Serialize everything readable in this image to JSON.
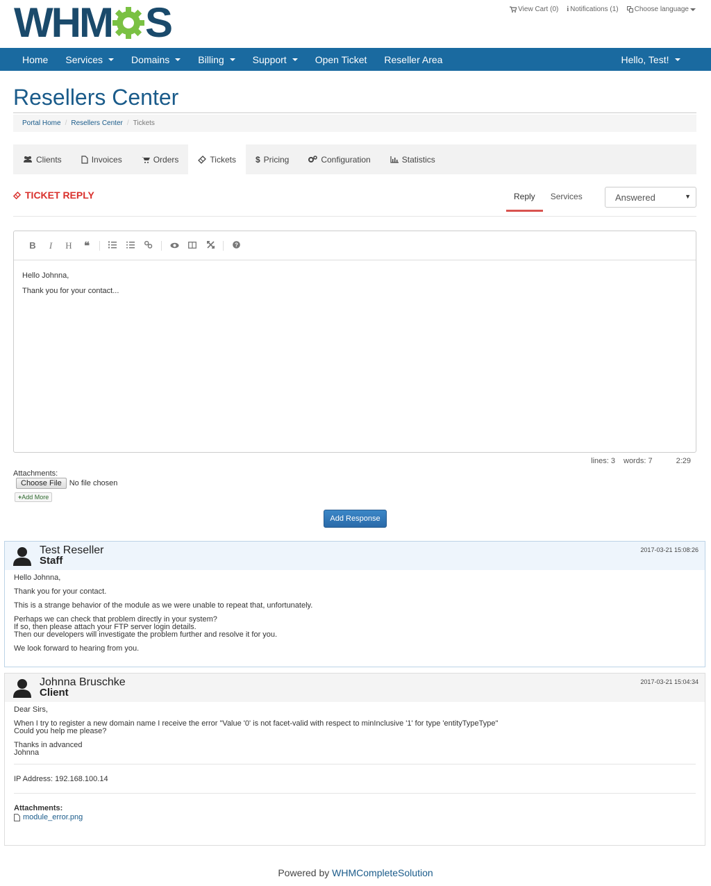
{
  "brand": {
    "logo_left": "WHM",
    "logo_right": "S",
    "logo_alt": "WHMCS"
  },
  "toplinks": {
    "cart": "View Cart (0)",
    "notifications": "Notifications (1)",
    "language": "Choose language"
  },
  "nav": {
    "items": [
      "Home",
      "Services",
      "Domains",
      "Billing",
      "Support",
      "Open Ticket",
      "Reseller Area"
    ],
    "user": "Hello, Test!"
  },
  "page": {
    "title": "Resellers Center"
  },
  "breadcrumb": {
    "items": [
      "Portal Home",
      "Resellers Center",
      "Tickets"
    ]
  },
  "tabs": [
    "Clients",
    "Invoices",
    "Orders",
    "Tickets",
    "Pricing",
    "Configuration",
    "Statistics"
  ],
  "ticket": {
    "heading": "TICKET REPLY",
    "subtabs": [
      "Reply",
      "Services"
    ],
    "status": "Answered",
    "editor_lines": [
      "Hello Johnna,",
      "Thank you for your contact..."
    ],
    "stats": {
      "lines": "lines: 3",
      "words": "words: 7",
      "cursor": "2:29"
    },
    "attachments_label": "Attachments:",
    "choose_file": "Choose File",
    "no_file": "No file chosen",
    "add_more": "Add More",
    "submit": "Add Response"
  },
  "replies": [
    {
      "name": "Test Reseller",
      "role": "Staff",
      "date": "2017-03-21 15:08:26",
      "paragraphs": [
        [
          "Hello Johnna,"
        ],
        [
          "Thank you for your contact."
        ],
        [
          "This is a strange behavior of the module as we were unable to repeat that, unfortunately."
        ],
        [
          "Perhaps we can check that problem directly in your system?",
          "If so, then please attach your FTP server login details.",
          "Then our developers will investigate the problem further and resolve it for you."
        ],
        [
          "We look forward to hearing from you."
        ]
      ]
    },
    {
      "name": "Johnna Bruschke",
      "role": "Client",
      "date": "2017-03-21 15:04:34",
      "paragraphs": [
        [
          "Dear Sirs,"
        ],
        [
          "When I try to register a new domain name I receive the error \"Value '0' is not facet-valid with respect to minInclusive '1' for type 'entityTypeType\"",
          "Could you help me please?"
        ],
        [
          "Thanks in advanced",
          "Johnna"
        ]
      ],
      "ip": "IP Address: 192.168.100.14",
      "attachments_title": "Attachments:",
      "attachment": "module_error.png"
    }
  ],
  "footer": {
    "prefix": "Powered by ",
    "link": "WHMCompleteSolution"
  },
  "colors": {
    "nav": "#1a6aa0",
    "title": "#1a5b8a",
    "accent": "#d9302c",
    "logo_gear": "#7ac143"
  }
}
